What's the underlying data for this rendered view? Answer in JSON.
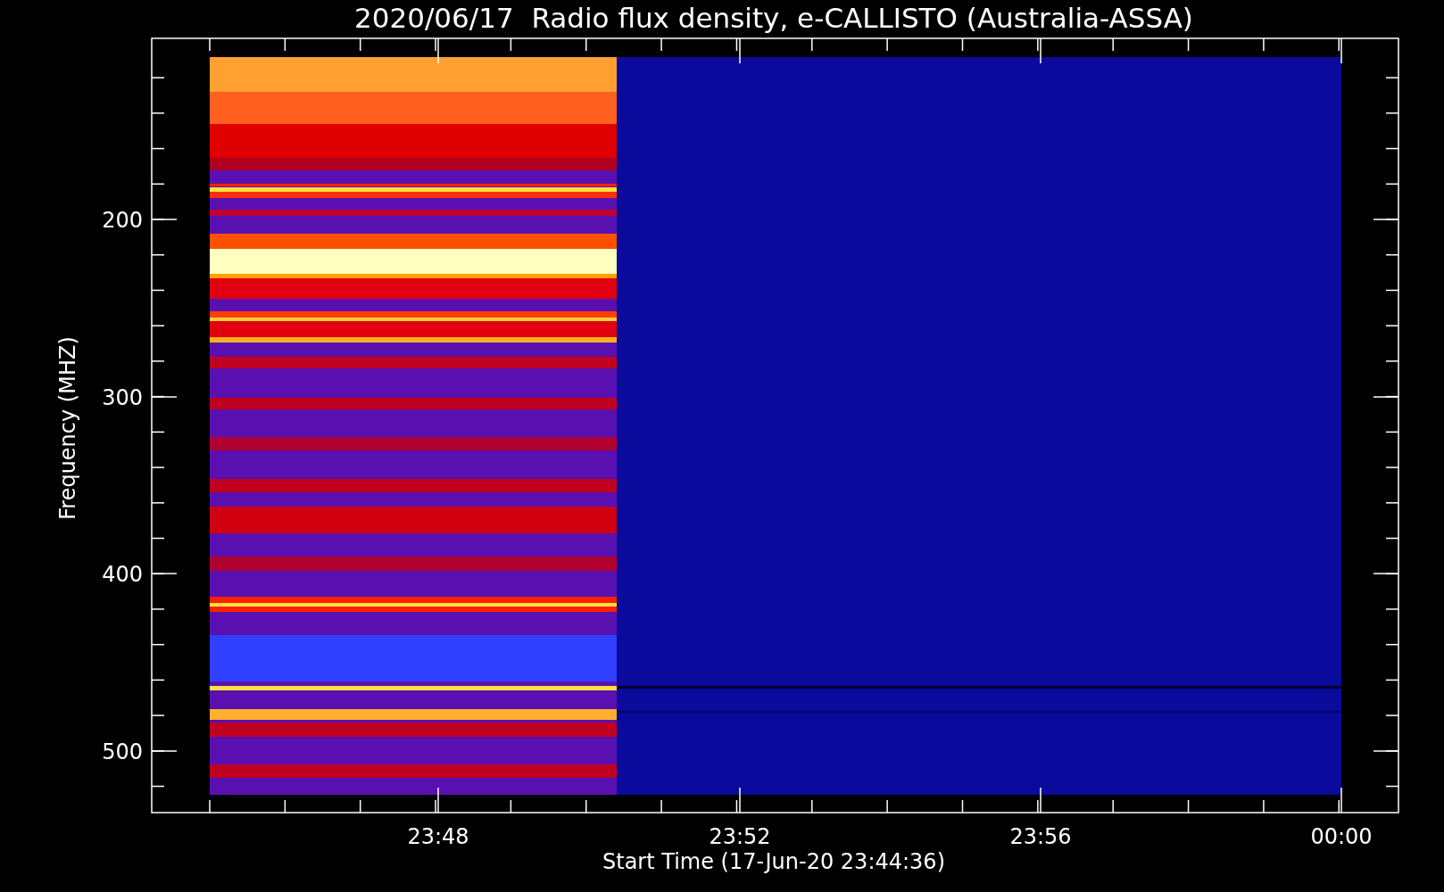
{
  "chart": {
    "title": "2020/06/17  Radio flux density, e-CALLISTO (Australia-ASSA)",
    "ylabel": "Frequency (MHZ)",
    "xlabel": "Start Time (17-Jun-20 23:44:36)",
    "yticks": [
      "200",
      "300",
      "400",
      "500"
    ],
    "xticks": [
      "23:48",
      "23:52",
      "23:56",
      "00:00"
    ]
  }
}
